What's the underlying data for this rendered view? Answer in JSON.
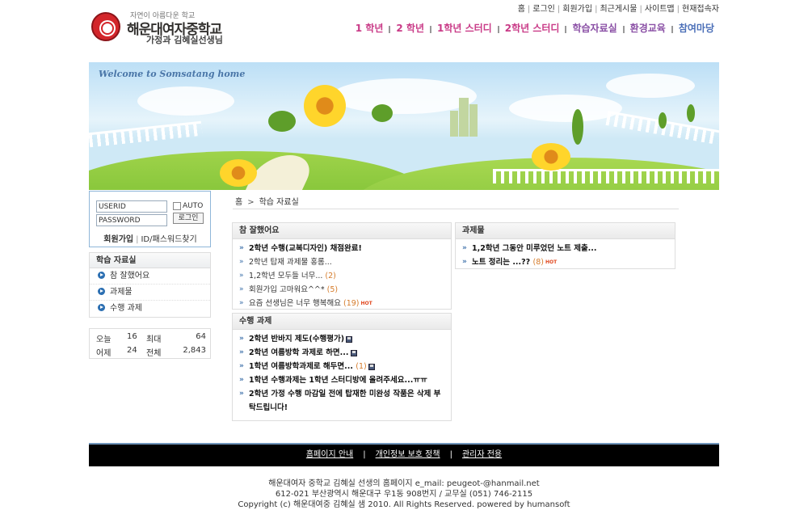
{
  "logo": {
    "slogan": "자연이 아름다운 학교",
    "school": "해운대여자중학교",
    "teacher": "가정과  김혜실선생님"
  },
  "top_menu": [
    "홈",
    "로그인",
    "회원가입",
    "최근게시물",
    "사이트맵",
    "현재접속자"
  ],
  "gnb": [
    {
      "label": "1 학년",
      "color": "#c93a87"
    },
    {
      "label": "2 학년",
      "color": "#c93a87"
    },
    {
      "label": "1학년 스터디",
      "color": "#c93a87"
    },
    {
      "label": "2학년 스터디",
      "color": "#c93a87"
    },
    {
      "label": "학습자료실",
      "color": "#8a4fa5"
    },
    {
      "label": "환경교육",
      "color": "#8a4fa5"
    },
    {
      "label": "참여마당",
      "color": "#4b6fb8"
    }
  ],
  "visual": {
    "welcome": "Welcome to Somsatang home"
  },
  "login": {
    "userid_value": "USERID",
    "password_value": "PASSWORD",
    "auto_label": "AUTO",
    "login_button": "로그인",
    "join_link": "회원가입",
    "find_link": "ID/패스워드찾기"
  },
  "submenu": {
    "title": "학습 자료실",
    "items": [
      "참 잘했어요",
      "과제물",
      "수행 과제"
    ]
  },
  "counter": {
    "today_label": "오늘",
    "today_value": "16",
    "max_label": "최대",
    "max_value": "64",
    "yesterday_label": "어제",
    "yesterday_value": "24",
    "total_label": "전체",
    "total_value": "2,843"
  },
  "breadcrumb": {
    "home": "홈",
    "arrow": ">",
    "current": "학습 자료실"
  },
  "boards": {
    "good": {
      "title": "참 잘했어요",
      "items": [
        {
          "text": "2학년 수행(교복디자인) 채점완료!",
          "count": ""
        },
        {
          "text": "2학년 탑재 과제물 홍롬...",
          "count": ""
        },
        {
          "text": "1,2학년 모두들 너무...",
          "count": "(2)"
        },
        {
          "text": "회원가입 고마워요^^*",
          "count": "(5)"
        },
        {
          "text": "요즘 선생님은 너무 행복해요",
          "count": "(19)",
          "hot": "HOT"
        }
      ]
    },
    "homework": {
      "title": "과제물",
      "items": [
        {
          "text": "1,2학년 그동안 미루었던 노트 제출...",
          "count": ""
        },
        {
          "text": "노트 정리는 ...??",
          "count": "(8)",
          "hot": "HOT"
        }
      ]
    },
    "task": {
      "title": "수행 과제",
      "items": [
        {
          "text": "2학년 반바지 제도(수행평가)",
          "count": ""
        },
        {
          "text": "2학년 여름방학 과제로 하면...",
          "count": ""
        },
        {
          "text": "1학년 여름방학과제로 해두면...",
          "count": "(1)"
        },
        {
          "text": "1학년 수행과제는 1학년 스터디방에 올려주세요...ㅠㅠ",
          "count": ""
        },
        {
          "text": "2학년 가정 수행 마감일 전에 탑재한 미완성 작품은 삭제 부탁드립니다!",
          "count": ""
        }
      ]
    }
  },
  "footer": {
    "links": [
      "홈페이지 안내",
      "개인정보 보호 정책",
      "관리자 전용"
    ],
    "line1": "해운대여자 중학교 김혜실 선생의 홈페이지 e_mail: peugeot-@hanmail.net",
    "line2": "612-021 부산광역시 해운대구 우1동 908번지 / 교무실 (051) 746-2115",
    "line3": "Copyright (c) 해운대여중 김혜실 샘 2010. All Rights Reserved. powered by humansoft"
  }
}
